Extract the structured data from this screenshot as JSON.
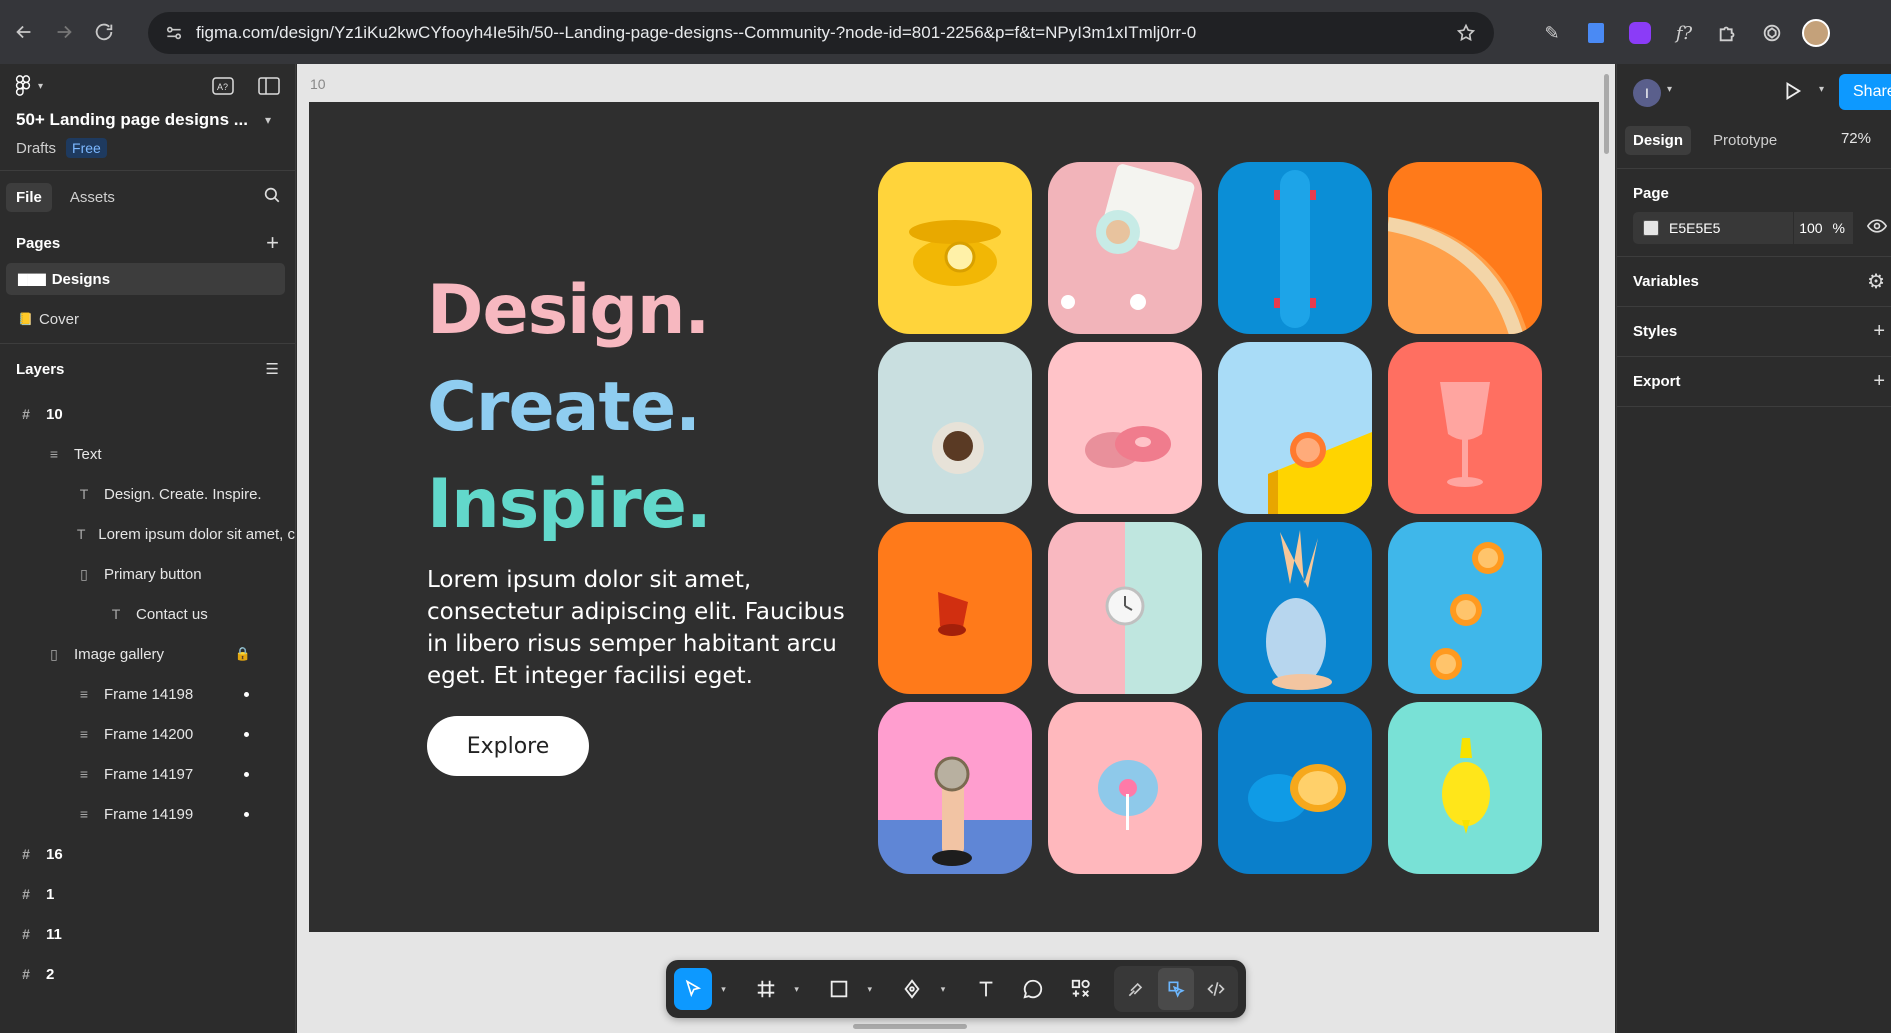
{
  "browser": {
    "url": "figma.com/design/Yz1iKu2kwCYfooyh4Ie5ih/50--Landing-page-designs--Community-?node-id=801-2256&p=f&t=NPyI3m1xITmlj0rr-0"
  },
  "left_panel": {
    "file_title": "50+ Landing page designs ...",
    "drafts_label": "Drafts",
    "plan_badge": "Free",
    "tabs": [
      "File",
      "Assets"
    ],
    "pages_heading": "Pages",
    "pages": [
      {
        "emoji": "▇▇▇",
        "label": "Designs"
      },
      {
        "emoji": "📒",
        "label": "Cover"
      }
    ],
    "layers_heading": "Layers",
    "layers": [
      {
        "icon": "#",
        "label": "10"
      },
      {
        "icon": "≡",
        "label": "Text"
      },
      {
        "icon": "T",
        "label": "Design. Create. Inspire."
      },
      {
        "icon": "T",
        "label": "Lorem ipsum dolor sit amet, c"
      },
      {
        "icon": "▯",
        "label": "Primary button"
      },
      {
        "icon": "T",
        "label": "Contact us"
      },
      {
        "icon": "▯",
        "label": "Image gallery"
      },
      {
        "icon": "≡",
        "label": "Frame 14198"
      },
      {
        "icon": "≡",
        "label": "Frame 14200"
      },
      {
        "icon": "≡",
        "label": "Frame 14197"
      },
      {
        "icon": "≡",
        "label": "Frame 14199"
      },
      {
        "icon": "#",
        "label": "16"
      },
      {
        "icon": "#",
        "label": "1"
      },
      {
        "icon": "#",
        "label": "11"
      },
      {
        "icon": "#",
        "label": "2"
      }
    ]
  },
  "canvas": {
    "frame_label": "10",
    "hero_lines": [
      "Design.",
      "Create.",
      "Inspire."
    ],
    "body_text": "Lorem ipsum dolor sit amet, consectetur adipiscing elit. Faucibus in libero risus semper habitant arcu eget. Et integer facilisi eget.",
    "button_label": "Explore",
    "tile_colors": [
      "#ffd43b",
      "#f2b4ba",
      "#0b8ed6",
      "#ff7a1a",
      "#c9dfe0",
      "#ffc3c8",
      "#a9dcf7",
      "#ff6f61",
      "#ff7a1a",
      "#f9b8c0",
      "#0b86d0",
      "#3fb7ea",
      "#ff9ecf",
      "#ffb8bd",
      "#0a7fcb",
      "#79e1d6"
    ]
  },
  "right_panel": {
    "user_initial": "I",
    "share_label": "Share",
    "tabs": [
      "Design",
      "Prototype"
    ],
    "zoom": "72%",
    "page_heading": "Page",
    "page_color": "E5E5E5",
    "page_opacity": "100",
    "opacity_unit": "%",
    "sections": [
      "Variables",
      "Styles",
      "Export"
    ]
  },
  "toolbar": {
    "tools": [
      "move-tool",
      "frame-tool",
      "shape-tool",
      "pen-tool",
      "text-tool",
      "comment-tool",
      "actions-tool"
    ],
    "modes": [
      "draw-mode",
      "design-mode",
      "dev-mode"
    ]
  },
  "help_label": "?"
}
